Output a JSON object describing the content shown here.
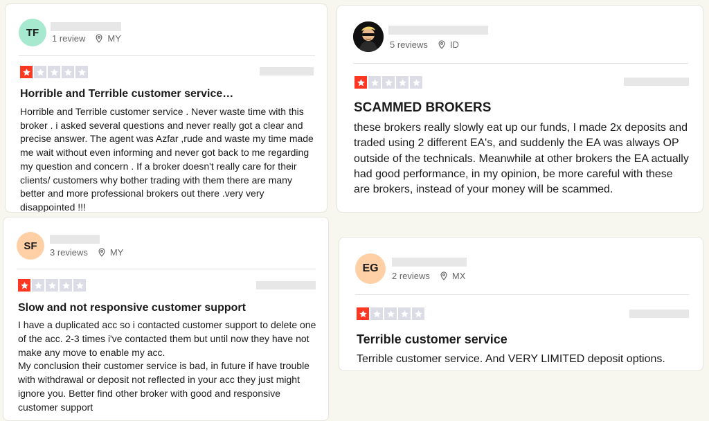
{
  "colors": {
    "star_active": "#ff3722",
    "star_inactive": "#dcdce6",
    "page_bg": "#f7f6ef"
  },
  "reviews": [
    {
      "initials": "TF",
      "avatar_color": "#a6e9cf",
      "review_count": "1 review",
      "country": "MY",
      "rating": 1,
      "title": "Horrible and Terrible customer service…",
      "body": [
        "Horrible and Terrible customer service . Never waste time with this broker . i asked several questions and never really got a clear and precise answer. The agent was Azfar ,rude and waste my time made me wait without even informing and never got back to me regarding my question and concern . If a broker doesn't really care for their clients/ customers why bother trading with them there are many better and more professional brokers out there .very very disappointed !!!"
      ]
    },
    {
      "initials": "",
      "avatar_type": "photo",
      "review_count": "5 reviews",
      "country": "ID",
      "rating": 1,
      "title": "SCAMMED BROKERS",
      "body": [
        "these brokers really slowly eat up our funds, I made 2x deposits and traded using 2 different EA's, and suddenly the EA was always OP outside of the technicals. Meanwhile at other brokers the EA actually had good performance, in my opinion, be more careful with these are brokers, instead of your money will be scammed."
      ]
    },
    {
      "initials": "SF",
      "avatar_color": "#ffd0a6",
      "review_count": "3 reviews",
      "country": "MY",
      "rating": 1,
      "title": "Slow and not responsive customer support",
      "body": [
        "I have a duplicated acc so i contacted customer support to delete one of the acc. 2-3 times i've contacted them but until now they have not make any move to enable my acc.",
        "My conclusion their customer service is bad, in future if have trouble with withdrawal or deposit not reflected in your acc they just might ignore you. Better find other broker with good and responsive customer support"
      ]
    },
    {
      "initials": "EG",
      "avatar_color": "#ffd0a6",
      "review_count": "2 reviews",
      "country": "MX",
      "rating": 1,
      "title": "Terrible customer service",
      "body": [
        "Terrible customer service. And VERY LIMITED deposit options."
      ]
    }
  ]
}
